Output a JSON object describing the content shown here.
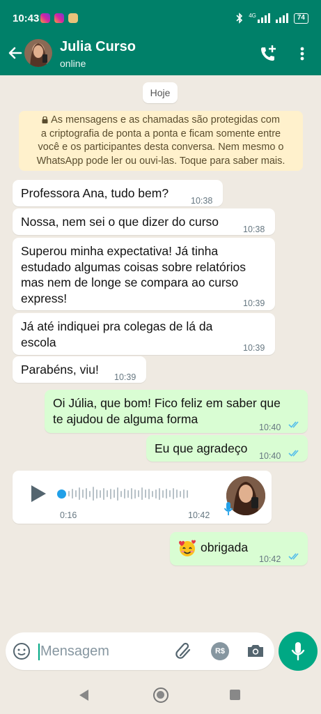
{
  "status_bar": {
    "time": "10:43",
    "network": "4G",
    "battery": "74"
  },
  "header": {
    "contact_name": "Julia Curso",
    "contact_status": "online"
  },
  "chat": {
    "date_chip": "Hoje",
    "encryption_notice": [
      "As mensagens e as chamadas são protegidas com",
      "a criptografia de ponta a ponta e ficam somente entre",
      "você e os participantes desta conversa. Nem mesmo o",
      "WhatsApp pode ler ou ouvi-las. Toque para saber mais."
    ],
    "messages": [
      {
        "direction": "in",
        "lines": [
          "Professora Ana, tudo bem?"
        ],
        "time": "10:38"
      },
      {
        "direction": "in",
        "lines": [
          "Nossa, nem sei o que dizer do curso"
        ],
        "time": "10:38"
      },
      {
        "direction": "in",
        "lines": [
          "Superou minha expectativa! Já tinha",
          "estudado algumas coisas sobre relatórios",
          "mas nem de longe se compara ao curso",
          "express!"
        ],
        "time": "10:39"
      },
      {
        "direction": "in",
        "lines": [
          "Já até indiquei pra colegas de lá da",
          "escola"
        ],
        "time": "10:39"
      },
      {
        "direction": "in",
        "lines": [
          "Parabéns, viu!"
        ],
        "time": "10:39"
      },
      {
        "direction": "out",
        "lines": [
          "Oi Júlia, que bom! Fico feliz em saber que",
          "te ajudou de alguma forma"
        ],
        "time": "10:40",
        "status": "read"
      },
      {
        "direction": "out",
        "lines": [
          "Eu que agradeço"
        ],
        "time": "10:40",
        "status": "read"
      },
      {
        "direction": "out",
        "emoji": "smiling-face-with-hearts",
        "lines": [
          "obrigada"
        ],
        "time": "10:42",
        "status": "read"
      }
    ],
    "voice_message": {
      "direction": "in",
      "duration": "0:16",
      "time": "10:42",
      "progress": 0
    }
  },
  "input_bar": {
    "placeholder": "Mensagem",
    "value": "",
    "payment_label": "R$"
  },
  "colors": {
    "header": "#008069",
    "accent": "#00a884",
    "incoming_bubble": "#ffffff",
    "outgoing_bubble": "#d9fdd3",
    "read_ticks": "#53bdeb",
    "chat_background": "#efeae2"
  }
}
